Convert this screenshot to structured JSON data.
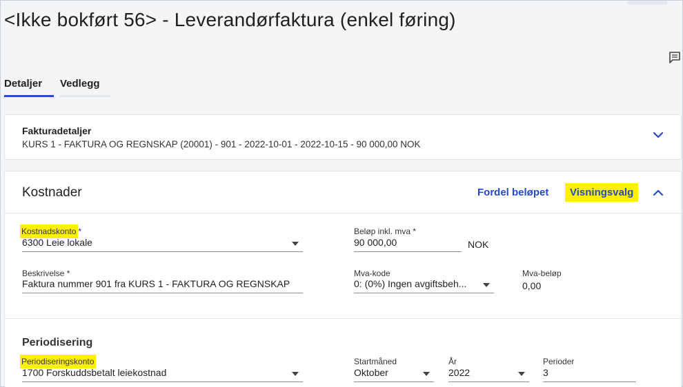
{
  "page": {
    "title": "<Ikke bokført 56> - Leverandørfaktura (enkel føring)"
  },
  "tabs": [
    {
      "label": "Detaljer",
      "active": true
    },
    {
      "label": "Vedlegg",
      "active": false
    }
  ],
  "invoice": {
    "heading": "Fakturadetaljer",
    "summary": "KURS 1 - FAKTURA OG REGNSKAP (20001) - 901 - 2022-10-01 - 2022-10-15 - 90 000,00 NOK"
  },
  "costs": {
    "title": "Kostnader",
    "distribute_label": "Fordel beløpet",
    "display_options_label": "Visningsvalg",
    "cost_account": {
      "label": "Kostnadskonto",
      "required": "*",
      "value": "6300 Leie lokale"
    },
    "amount": {
      "label": "Beløp inkl. mva *",
      "value": "90 000,00",
      "currency": "NOK"
    },
    "description": {
      "label": "Beskrivelse *",
      "value": "Faktura nummer 901 fra KURS 1 - FAKTURA OG REGNSKAP"
    },
    "vat_code": {
      "label": "Mva-kode",
      "value": "0: (0%) Ingen avgiftsbeh..."
    },
    "vat_amount": {
      "label": "Mva-beløp",
      "value": "0,00"
    }
  },
  "accrual": {
    "title": "Periodisering",
    "account": {
      "label": "Periodiseringskonto",
      "value": "1700 Forskuddsbetalt leiekostnad"
    },
    "start_month": {
      "label": "Startmåned",
      "value": "Oktober"
    },
    "year": {
      "label": "År",
      "value": "2022"
    },
    "periods": {
      "label": "Perioder",
      "value": "3"
    }
  },
  "colors": {
    "accent": "#2649c6",
    "highlight": "#fff200"
  },
  "icons": [
    "comment-icon",
    "chevron-down-icon",
    "chevron-up-icon",
    "caret-down-icon"
  ]
}
